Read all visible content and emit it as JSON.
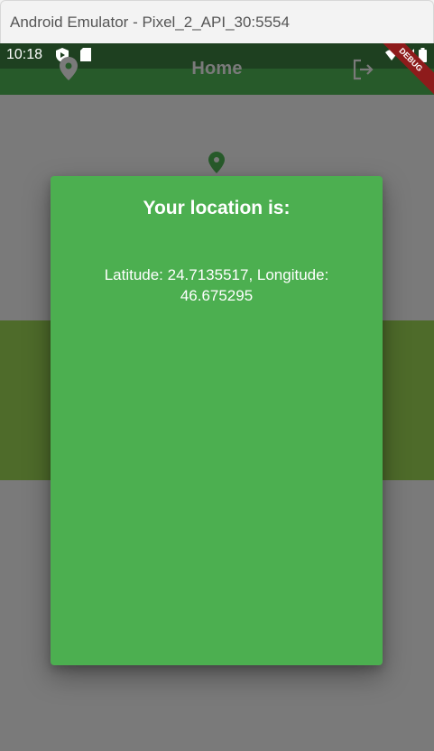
{
  "window": {
    "title": "Android Emulator - Pixel_2_API_30:5554"
  },
  "status_bar": {
    "time": "10:18"
  },
  "app_bar": {
    "title": "Home",
    "left_icon": "location-pin-icon",
    "right_icon": "logout-icon"
  },
  "debug_banner": {
    "label": "DEBUG"
  },
  "dialog": {
    "title": "Your location is:",
    "message": "Latitude: 24.7135517, Longitude: 46.675295"
  },
  "colors": {
    "app_bar": "#275a2a",
    "status_bar": "#1e4020",
    "dialog": "#4caf50",
    "scrim": "#7a7a7a",
    "band": "#4e6b2a",
    "debug": "#8e1b1b"
  }
}
